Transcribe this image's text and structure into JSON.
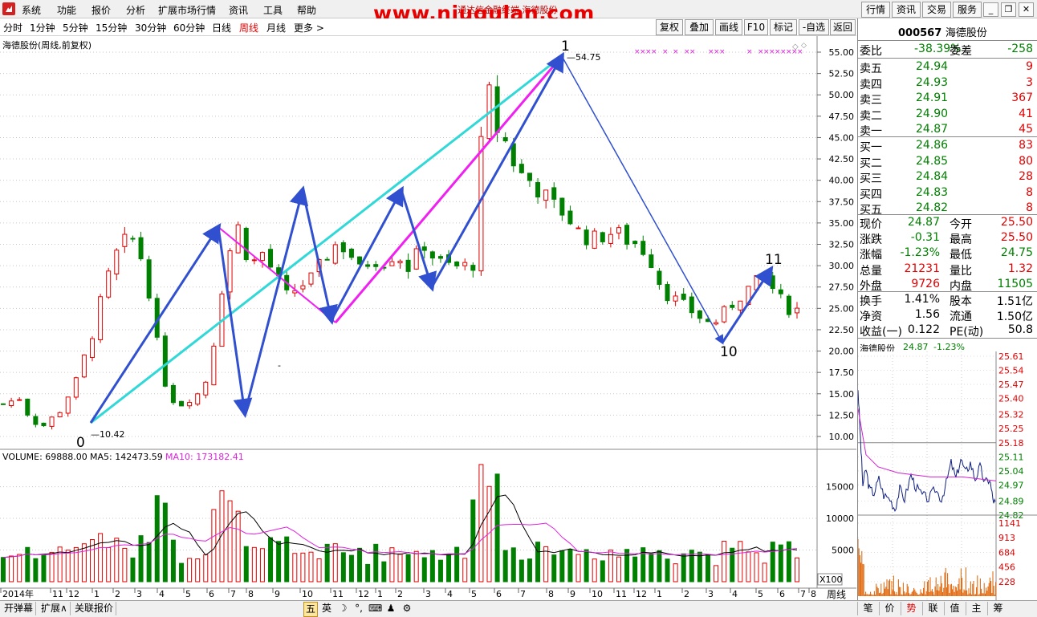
{
  "menu": {
    "items": [
      "系统",
      "功能",
      "报价",
      "分析",
      "扩展市场行情",
      "资讯",
      "工具",
      "帮助"
    ],
    "watermark": "www.niugulan.com",
    "subtitle": "通达信金融终端    海德股份",
    "right_buttons": [
      "行情",
      "资讯",
      "交易",
      "服务"
    ]
  },
  "periods": {
    "items": [
      "分时",
      "1分钟",
      "5分钟",
      "15分钟",
      "30分钟",
      "60分钟",
      "日线",
      "周线",
      "月线",
      "更多 >"
    ],
    "active": "周线",
    "buttons": [
      "复权",
      "叠加",
      "画线",
      "F10",
      "标记",
      "-自选",
      "返回"
    ]
  },
  "chart": {
    "title": "海德股份(周线,前复权)",
    "y_ticks": [
      "55.00",
      "52.50",
      "50.00",
      "47.50",
      "45.00",
      "42.50",
      "40.00",
      "37.50",
      "35.00",
      "32.50",
      "30.00",
      "27.50",
      "25.00",
      "22.50",
      "20.00",
      "17.50",
      "15.00",
      "12.50",
      "10.00"
    ],
    "labels": {
      "p0": "0",
      "p0_price": "10.42",
      "p1": "1",
      "p1_price": "54.75",
      "p10": "10",
      "p11": "11"
    },
    "volume_info": {
      "volume": "VOLUME: 69888.00",
      "ma5": "MA5: 142473.59",
      "ma10": "MA10: 173182.41"
    },
    "vol_ticks": [
      "15000",
      "10000",
      "5000"
    ],
    "vol_unit": "X100",
    "x_labels": [
      "2014年",
      "11",
      "12",
      "1",
      "2",
      "3",
      "4",
      "5",
      "6",
      "7",
      "8",
      "9",
      "10",
      "11",
      "12",
      "1",
      "2",
      "3",
      "4",
      "5",
      "6",
      "7",
      "8",
      "9",
      "10",
      "11",
      "12",
      "1",
      "2",
      "3",
      "4",
      "5",
      "6",
      "7",
      "8"
    ],
    "period_label": "周线"
  },
  "quote": {
    "code": "000567",
    "name": "海德股份",
    "weibi_label": "委比",
    "weibi": "-38.39%",
    "weicha_label": "委差",
    "weicha": "-258",
    "asks": [
      {
        "l": "卖五",
        "p": "24.94",
        "v": "9"
      },
      {
        "l": "卖四",
        "p": "24.93",
        "v": "3"
      },
      {
        "l": "卖三",
        "p": "24.91",
        "v": "367"
      },
      {
        "l": "卖二",
        "p": "24.90",
        "v": "41"
      },
      {
        "l": "卖一",
        "p": "24.87",
        "v": "45"
      }
    ],
    "bids": [
      {
        "l": "买一",
        "p": "24.86",
        "v": "83"
      },
      {
        "l": "买二",
        "p": "24.85",
        "v": "80"
      },
      {
        "l": "买三",
        "p": "24.84",
        "v": "28"
      },
      {
        "l": "买四",
        "p": "24.83",
        "v": "8"
      },
      {
        "l": "买五",
        "p": "24.82",
        "v": "8"
      }
    ],
    "stats": [
      {
        "l1": "现价",
        "v1": "24.87",
        "c1": "green",
        "l2": "今开",
        "v2": "25.50",
        "c2": "red"
      },
      {
        "l1": "涨跌",
        "v1": "-0.31",
        "c1": "green",
        "l2": "最高",
        "v2": "25.50",
        "c2": "red"
      },
      {
        "l1": "涨幅",
        "v1": "-1.23%",
        "c1": "green",
        "l2": "最低",
        "v2": "24.75",
        "c2": "green"
      },
      {
        "l1": "总量",
        "v1": "21231",
        "c1": "red",
        "l2": "量比",
        "v2": "1.32",
        "c2": "red"
      },
      {
        "l1": "外盘",
        "v1": "9726",
        "c1": "red",
        "l2": "内盘",
        "v2": "11505",
        "c2": "green"
      }
    ],
    "fin": [
      {
        "l1": "换手",
        "v1": "1.41%",
        "l2": "股本",
        "v2": "1.51亿"
      },
      {
        "l1": "净资",
        "v1": "1.56",
        "l2": "流通",
        "v2": "1.50亿"
      },
      {
        "l1": "收益(一)",
        "v1": "0.122",
        "l2": "PE(动)",
        "v2": "50.8"
      }
    ],
    "mini_title": "海德股份",
    "mini_price": "24.87",
    "mini_pct": "-1.23%",
    "mini_ticks": [
      "25.61",
      "25.54",
      "25.47",
      "25.40",
      "25.32",
      "25.25",
      "25.18",
      "25.11",
      "25.04",
      "24.97",
      "24.89",
      "24.82"
    ],
    "mini_vol_ticks": [
      "1141",
      "913",
      "684",
      "456",
      "228"
    ]
  },
  "bottom": {
    "left": [
      "开弹幕",
      "扩展∧",
      "关联报价"
    ],
    "ime": [
      "五",
      "英",
      "☽",
      "°,",
      "⌨",
      "♟",
      "⚙"
    ],
    "tabs": [
      "笔",
      "价",
      "势",
      "联",
      "值",
      "主",
      "筹"
    ],
    "active_tab": "势"
  },
  "colors": {
    "up": "#e00000",
    "down": "#008000",
    "wave": "#3050d0",
    "cyan": "#30d8d8",
    "magenta": "#f020f0",
    "ma5": "#000000",
    "ma10": "#e020e0"
  }
}
